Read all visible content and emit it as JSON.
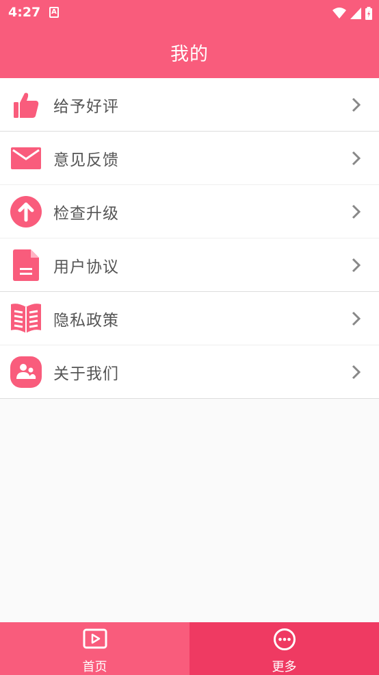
{
  "status_bar": {
    "time": "4:27",
    "app_badge": "A"
  },
  "header": {
    "title": "我的"
  },
  "menu": {
    "items": [
      {
        "label": "给予好评",
        "icon": "thumbs-up-icon"
      },
      {
        "label": "意见反馈",
        "icon": "mail-icon"
      },
      {
        "label": "检查升级",
        "icon": "upgrade-arrow-icon"
      },
      {
        "label": "用户协议",
        "icon": "document-icon"
      },
      {
        "label": "隐私政策",
        "icon": "book-icon"
      },
      {
        "label": "关于我们",
        "icon": "people-icon"
      }
    ]
  },
  "tabs": [
    {
      "label": "首页",
      "icon": "play-video-icon",
      "selected": false
    },
    {
      "label": "更多",
      "icon": "more-dots-icon",
      "selected": true
    }
  ],
  "colors": {
    "primary": "#f95c7c",
    "selected_tab": "#ef3a62",
    "text": "#555555"
  }
}
